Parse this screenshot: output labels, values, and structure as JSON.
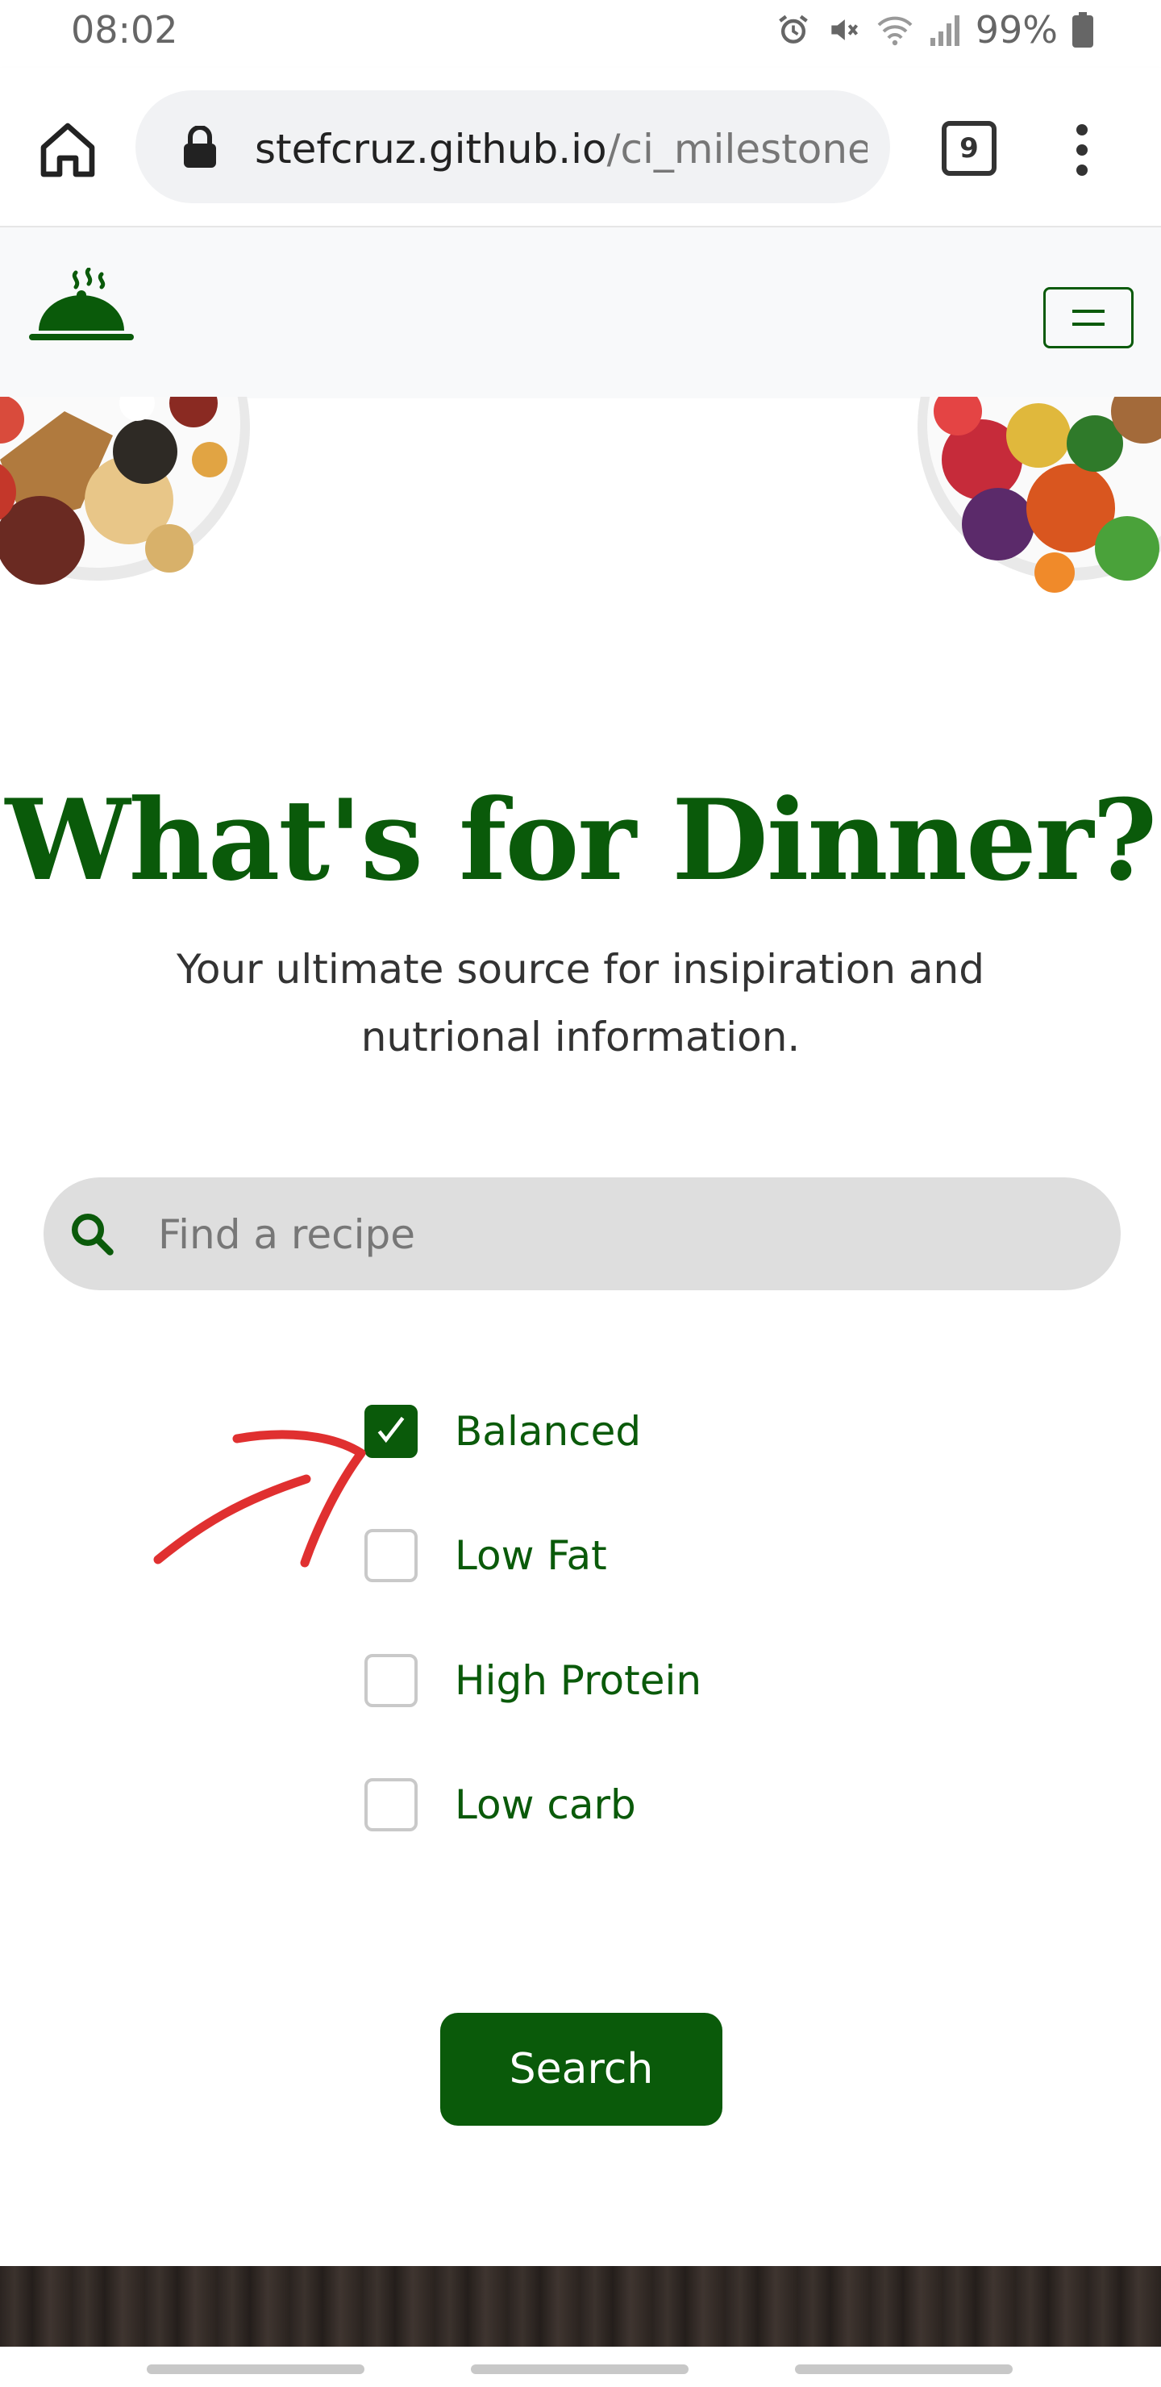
{
  "status_bar": {
    "time": "08:02",
    "battery": "99%",
    "icons": [
      "alarm-icon",
      "mute-icon",
      "wifi-icon",
      "signal-icon",
      "battery-icon"
    ]
  },
  "browser": {
    "url_domain": "stefcruz.github.io",
    "url_path": "/ci_milestone",
    "tab_count": "9",
    "icons": [
      "home-icon",
      "lock-icon",
      "tabs-icon",
      "overflow-menu-icon"
    ]
  },
  "navbar": {
    "logo_icon": "cloche-icon",
    "menu_icon": "hamburger-icon"
  },
  "hero": {
    "title": "What's for Dinner?",
    "subtitle": "Your ultimate source for insipiration and nutrional information."
  },
  "search": {
    "placeholder": "Find a recipe",
    "icon": "search-icon"
  },
  "filters": [
    {
      "label": "Balanced",
      "checked": true
    },
    {
      "label": "Low Fat",
      "checked": false
    },
    {
      "label": "High Protein",
      "checked": false
    },
    {
      "label": "Low carb",
      "checked": false
    }
  ],
  "search_button": {
    "label": "Search"
  },
  "colors": {
    "brand_green": "#0a5a0a",
    "annotation_red": "#e03030",
    "search_bg": "#dedede"
  }
}
